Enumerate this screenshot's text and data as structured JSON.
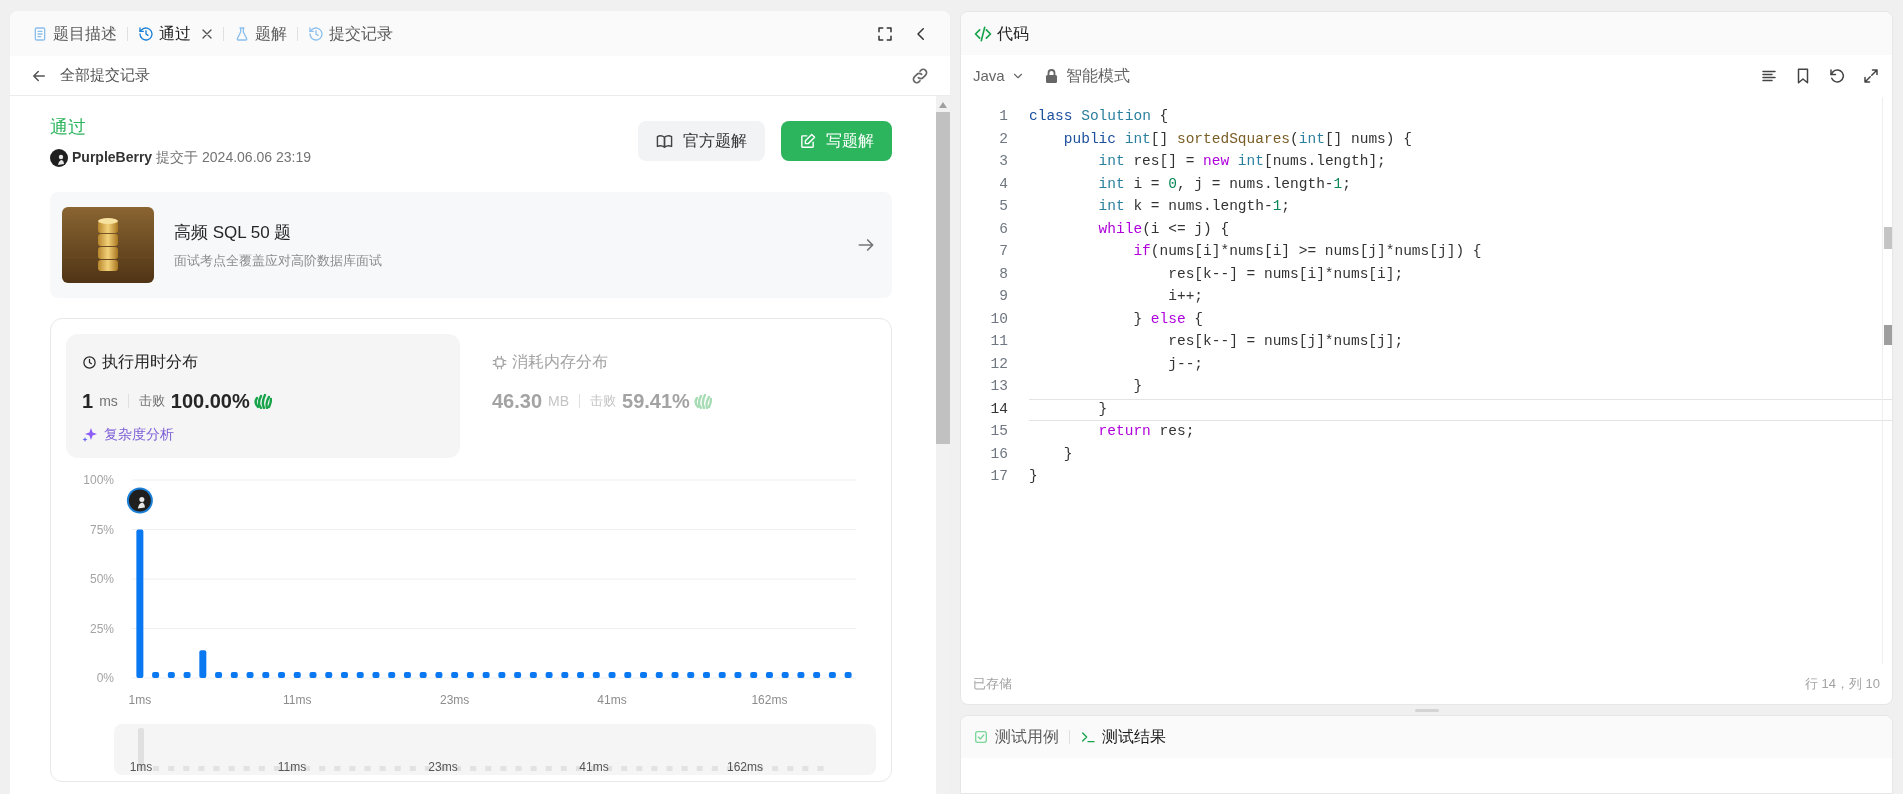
{
  "left_panel": {
    "tabs": [
      {
        "kind": "description",
        "label": "题目描述",
        "selected": false,
        "closable": false
      },
      {
        "kind": "result",
        "label": "通过",
        "selected": true,
        "closable": true
      },
      {
        "kind": "solution",
        "label": "题解",
        "selected": false,
        "closable": false
      },
      {
        "kind": "submissions",
        "label": "提交记录",
        "selected": false,
        "closable": false
      }
    ],
    "back_link": "全部提交记录",
    "submission": {
      "status": "通过",
      "user": "PurpleBerry",
      "submitted_at": "提交于 2024.06.06 23:19",
      "buttons": [
        {
          "kind": "official",
          "label": "官方题解"
        },
        {
          "kind": "write",
          "label": "写题解"
        }
      ]
    },
    "course": {
      "title": "高频 SQL 50 题",
      "subtitle": "面试考点全覆盖应对高阶数据库面试"
    },
    "stats": [
      {
        "kind": "runtime",
        "title": "执行用时分布",
        "value": "1",
        "unit": "ms",
        "beats_label": "击败",
        "beats": "100.00%",
        "selected": true
      },
      {
        "kind": "memory",
        "title": "消耗内存分布",
        "value": "46.30",
        "unit": "MB",
        "beats_label": "击败",
        "beats": "59.41%",
        "selected": false
      }
    ],
    "analysis_link": "复杂度分析",
    "chart_data": {
      "type": "bar",
      "ylim": [
        0,
        100
      ],
      "grid": true,
      "categories": [
        "1ms",
        null,
        null,
        null,
        null,
        null,
        null,
        null,
        null,
        null,
        "11ms",
        null,
        null,
        null,
        null,
        null,
        null,
        null,
        null,
        null,
        "23ms",
        null,
        null,
        null,
        null,
        null,
        null,
        null,
        null,
        null,
        "41ms",
        null,
        null,
        null,
        null,
        null,
        null,
        null,
        null,
        null,
        "162ms",
        null,
        null,
        null,
        null,
        null
      ],
      "values": [
        75,
        3,
        3,
        3,
        14,
        3,
        3,
        3,
        3,
        3,
        3,
        3,
        3,
        3,
        3,
        3,
        3,
        3,
        3,
        3,
        3,
        3,
        3,
        3,
        3,
        3,
        3,
        3,
        3,
        3,
        3,
        3,
        3,
        3,
        3,
        3,
        3,
        3,
        3,
        3,
        3,
        3,
        3,
        3,
        3,
        3
      ],
      "yticks": [
        {
          "value": 0,
          "label": "0%"
        },
        {
          "value": 25,
          "label": "25%"
        },
        {
          "value": 50,
          "label": "50%"
        },
        {
          "value": 75,
          "label": "75%"
        },
        {
          "value": 100,
          "label": "100%"
        }
      ]
    },
    "brush_labels": [
      "1ms",
      "11ms",
      "23ms",
      "41ms",
      "162ms"
    ]
  },
  "code_panel": {
    "title": "代码",
    "language": "Java",
    "mode": "智能模式",
    "lines": [
      {
        "number": "1",
        "current": false,
        "tokens": [
          {
            "kind": "kw",
            "text": "class"
          },
          {
            "kind": "type",
            "text": " Solution"
          },
          {
            "kind": "plain",
            "text": " {"
          }
        ]
      },
      {
        "number": "2",
        "current": false,
        "tokens": [
          {
            "kind": "kw",
            "text": "    public"
          },
          {
            "kind": "type",
            "text": " int"
          },
          {
            "kind": "plain",
            "text": "[]"
          },
          {
            "kind": "fn",
            "text": " sortedSquares"
          },
          {
            "kind": "plain",
            "text": "("
          },
          {
            "kind": "type",
            "text": "int"
          },
          {
            "kind": "plain",
            "text": "[] nums) {"
          }
        ]
      },
      {
        "number": "3",
        "current": false,
        "tokens": [
          {
            "kind": "type",
            "text": "        int"
          },
          {
            "kind": "plain",
            "text": " res[] ="
          },
          {
            "kind": "ctrl",
            "text": " new"
          },
          {
            "kind": "type",
            "text": " int"
          },
          {
            "kind": "plain",
            "text": "[nums.length];"
          }
        ]
      },
      {
        "number": "4",
        "current": false,
        "tokens": [
          {
            "kind": "type",
            "text": "        int"
          },
          {
            "kind": "plain",
            "text": " i ="
          },
          {
            "kind": "num",
            "text": " 0"
          },
          {
            "kind": "plain",
            "text": ", j = nums.length-"
          },
          {
            "kind": "num",
            "text": "1"
          },
          {
            "kind": "plain",
            "text": ";"
          }
        ]
      },
      {
        "number": "5",
        "current": false,
        "tokens": [
          {
            "kind": "type",
            "text": "        int"
          },
          {
            "kind": "plain",
            "text": " k = nums.length-"
          },
          {
            "kind": "num",
            "text": "1"
          },
          {
            "kind": "plain",
            "text": ";"
          }
        ]
      },
      {
        "number": "6",
        "current": false,
        "tokens": [
          {
            "kind": "ctrl",
            "text": "        while"
          },
          {
            "kind": "plain",
            "text": "(i <= j) {"
          }
        ]
      },
      {
        "number": "7",
        "current": false,
        "tokens": [
          {
            "kind": "ctrl",
            "text": "            if"
          },
          {
            "kind": "plain",
            "text": "(nums[i]*nums[i] >= nums[j]*nums[j]) {"
          }
        ]
      },
      {
        "number": "8",
        "current": false,
        "tokens": [
          {
            "kind": "plain",
            "text": "                res[k--] = nums[i]*nums[i];"
          }
        ]
      },
      {
        "number": "9",
        "current": false,
        "tokens": [
          {
            "kind": "plain",
            "text": "                i++;"
          }
        ]
      },
      {
        "number": "10",
        "current": false,
        "tokens": [
          {
            "kind": "plain",
            "text": "            }"
          },
          {
            "kind": "ctrl",
            "text": " else"
          },
          {
            "kind": "plain",
            "text": " {"
          }
        ]
      },
      {
        "number": "11",
        "current": false,
        "tokens": [
          {
            "kind": "plain",
            "text": "                res[k--] = nums[j]*nums[j];"
          }
        ]
      },
      {
        "number": "12",
        "current": false,
        "tokens": [
          {
            "kind": "plain",
            "text": "                j--;"
          }
        ]
      },
      {
        "number": "13",
        "current": false,
        "tokens": [
          {
            "kind": "plain",
            "text": "            }"
          }
        ]
      },
      {
        "number": "14",
        "current": true,
        "tokens": [
          {
            "kind": "plain",
            "text": "        }"
          }
        ]
      },
      {
        "number": "15",
        "current": false,
        "tokens": [
          {
            "kind": "ctrl",
            "text": "        return"
          },
          {
            "kind": "plain",
            "text": " res;"
          }
        ]
      },
      {
        "number": "16",
        "current": false,
        "tokens": [
          {
            "kind": "plain",
            "text": "    }"
          }
        ]
      },
      {
        "number": "17",
        "current": false,
        "tokens": [
          {
            "kind": "plain",
            "text": "}"
          }
        ]
      }
    ],
    "save_status": "已存储",
    "cursor": "行 14，列 10"
  },
  "test_panel": {
    "tabs": [
      {
        "kind": "cases",
        "label": "测试用例",
        "selected": false
      },
      {
        "kind": "result",
        "label": "测试结果",
        "selected": true
      }
    ]
  }
}
